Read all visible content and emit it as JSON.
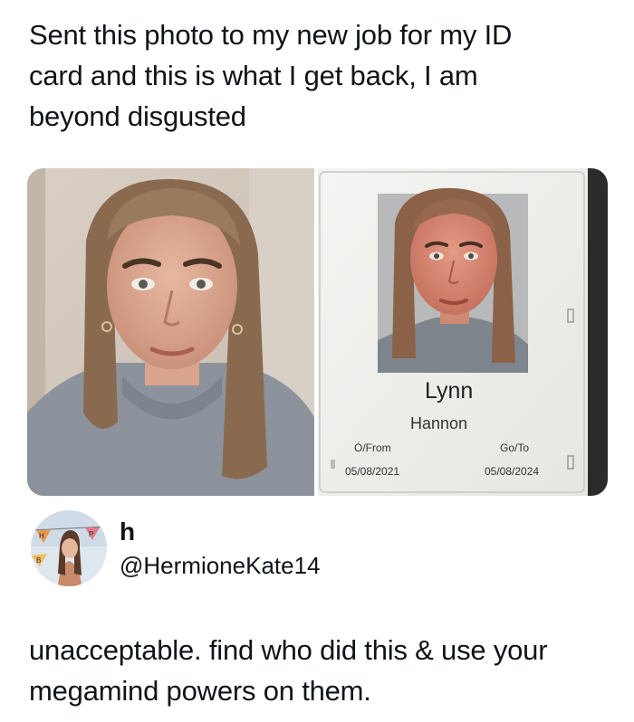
{
  "post": {
    "caption_lines": [
      "Sent this photo to my new job for my ID",
      "card and this is what I get back, I am",
      "beyond disgusted"
    ]
  },
  "id_card": {
    "first_name": "Lynn",
    "last_name": "Hannon",
    "from_label": "Ó/From",
    "to_label": "Go/To",
    "from_date": "05/08/2021",
    "to_date": "05/08/2024"
  },
  "quoted_user": {
    "display_name": "h",
    "handle": "@HermioneKate14",
    "avatar_banner_letters": [
      "H",
      "P",
      "B"
    ]
  },
  "reply": {
    "lines": [
      "unacceptable. find who did this & use your",
      "megamind powers on them."
    ]
  },
  "colors": {
    "text": "#0f1419",
    "background": "#ffffff"
  }
}
